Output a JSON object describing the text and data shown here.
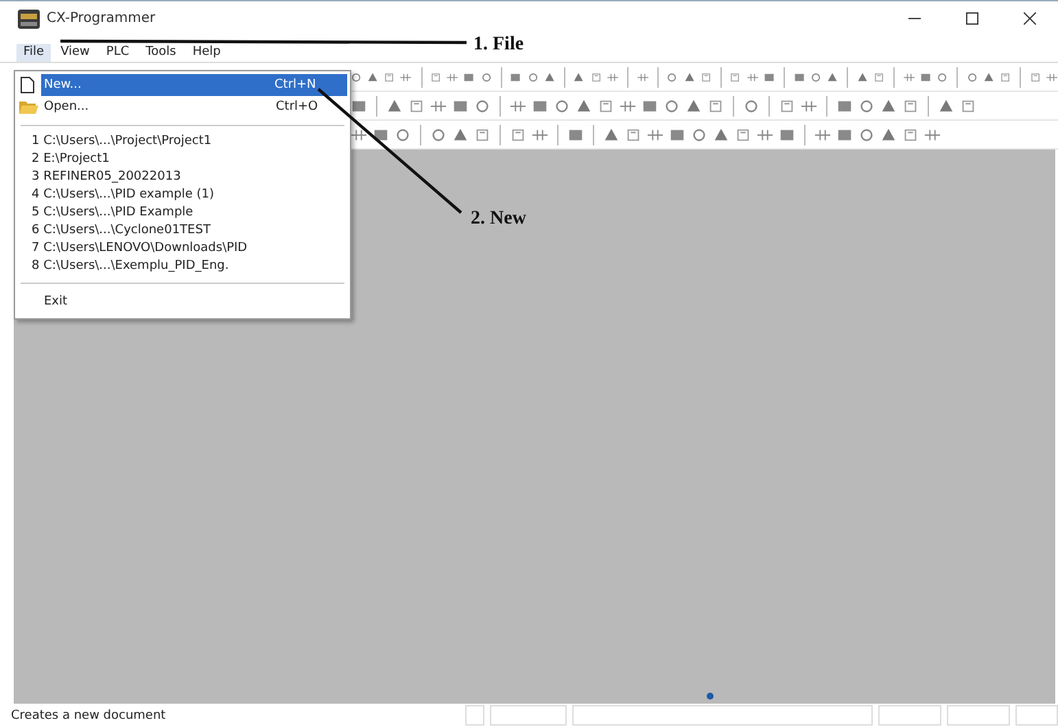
{
  "window": {
    "title": "CX-Programmer"
  },
  "menu_bar": [
    {
      "label": "File",
      "selected": true
    },
    {
      "label": "View",
      "selected": false
    },
    {
      "label": "PLC",
      "selected": false
    },
    {
      "label": "Tools",
      "selected": false
    },
    {
      "label": "Help",
      "selected": false
    }
  ],
  "file_menu": {
    "items": [
      {
        "kind": "command",
        "label": "New...",
        "shortcut": "Ctrl+N",
        "selected": true
      },
      {
        "kind": "command",
        "label": "Open...",
        "shortcut": "Ctrl+O",
        "selected": false
      },
      {
        "kind": "separator"
      },
      {
        "kind": "recent",
        "label": "1 C:\\Users\\...\\Project\\Project1",
        "selected": false
      },
      {
        "kind": "recent",
        "label": "2 E:\\Project1",
        "selected": false
      },
      {
        "kind": "recent",
        "label": "3 REFINER05_20022013",
        "selected": false
      },
      {
        "kind": "recent",
        "label": "4 C:\\Users\\...\\PID example (1)",
        "selected": false
      },
      {
        "kind": "recent",
        "label": "5 C:\\Users\\...\\PID Example",
        "selected": false
      },
      {
        "kind": "recent",
        "label": "6 C:\\Users\\...\\Cyclone01TEST",
        "selected": false
      },
      {
        "kind": "recent",
        "label": "7 C:\\Users\\LENOVO\\Downloads\\PID",
        "selected": false
      },
      {
        "kind": "recent",
        "label": "8 C:\\Users\\...\\Exemplu_PID_Eng.",
        "selected": false
      },
      {
        "kind": "separator"
      },
      {
        "kind": "command",
        "label": "Exit",
        "selected": false
      }
    ]
  },
  "annotations": [
    {
      "label": "1. File"
    },
    {
      "label": "2. New"
    }
  ],
  "status_bar": {
    "message": "Creates a new document"
  }
}
